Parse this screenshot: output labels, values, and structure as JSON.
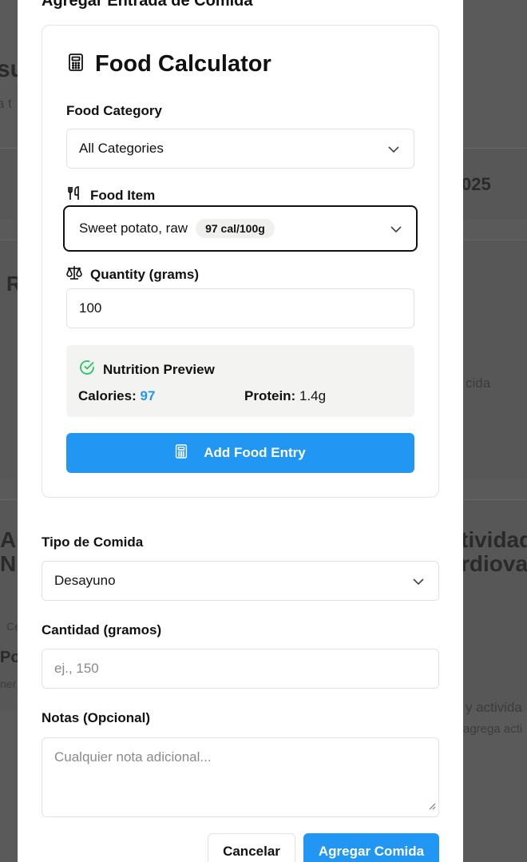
{
  "background": {
    "frag_su": "su",
    "frag_a_t": "a t",
    "frag_2025": "025",
    "frag_r": "R",
    "frag_cida": "cida",
    "frag_a": "A",
    "frag_n": "N",
    "frag_tividad": "tividad",
    "frag_rdiovas": "rdiovas",
    "frag_ce": "Ce",
    "frag_pol": "Pol",
    "frag_ner": "ner",
    "frag_y_activida": "y activida",
    "frag_agrega_acti": "agrega acti"
  },
  "modal": {
    "title": "Agregar Entrada de Comida"
  },
  "calculator": {
    "title": "Food Calculator",
    "icon": "calculator-icon",
    "category_label": "Food Category",
    "category_value": "All Categories",
    "item_label": "Food Item",
    "item_icon": "utensils-icon",
    "item_value": "Sweet potato, raw",
    "item_badge": "97 cal/100g",
    "quantity_label": "Quantity (grams)",
    "quantity_icon": "scale-icon",
    "quantity_value": "100",
    "preview": {
      "title": "Nutrition Preview",
      "icon": "check-circle-icon",
      "calories_label": "Calories:",
      "calories_value": "97",
      "protein_label": "Protein:",
      "protein_value": "1.4g"
    },
    "add_button": "Add Food Entry"
  },
  "form": {
    "meal_type_label": "Tipo de Comida",
    "meal_type_value": "Desayuno",
    "amount_label": "Cantidad (gramos)",
    "amount_placeholder": "ej., 150",
    "notes_label": "Notas (Opcional)",
    "notes_placeholder": "Cualquier nota adicional..."
  },
  "actions": {
    "cancel": "Cancelar",
    "submit": "Agregar Comida"
  },
  "colors": {
    "accent": "#2196f3",
    "success": "#22c55e"
  }
}
